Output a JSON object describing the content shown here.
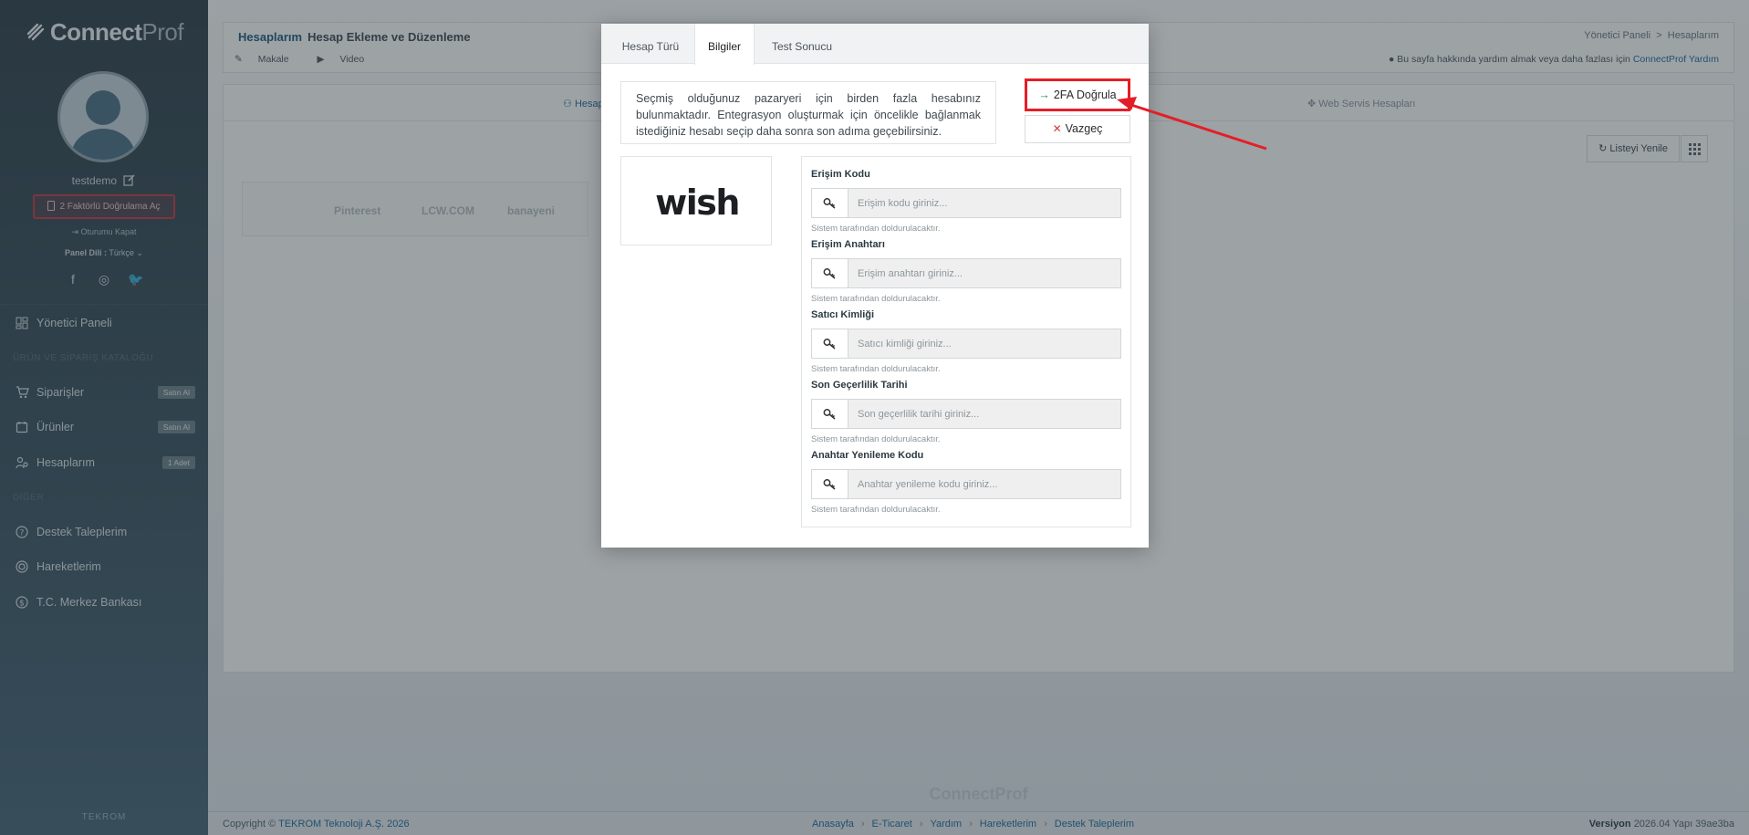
{
  "brand": {
    "name_bold": "Connect",
    "name_light": "Prof",
    "footer_brand": "TEKROM",
    "bottom_logo": "ConnectProf"
  },
  "user": {
    "name": "testdemo",
    "twofa_label": "2 Faktörlü Doğrulama Aç",
    "logout_label": "Oturumu Kapat",
    "panel_lang_label": "Panel Dili :",
    "panel_lang_value": "Türkçe"
  },
  "sidebar": {
    "items": [
      {
        "label": "Yönetici Paneli",
        "icon": "dashboard-icon"
      },
      {
        "section": "ÜRÜN VE SİPARİŞ KATALOĞU"
      },
      {
        "label": "Siparişler",
        "badge": "Satın Al",
        "icon": "cart-icon"
      },
      {
        "label": "Ürünler",
        "badge": "Satın Al",
        "icon": "tag-icon"
      },
      {
        "label": "Hesaplarım",
        "badge": "1 Adet",
        "icon": "users-icon"
      },
      {
        "section": "DİĞER"
      },
      {
        "label": "Destek Taleplerim",
        "icon": "help-icon"
      },
      {
        "label": "Hareketlerim",
        "icon": "activity-icon"
      },
      {
        "label": "T.C. Merkez Bankası",
        "icon": "currency-icon"
      }
    ]
  },
  "header": {
    "title": "Hesaplarım",
    "subtitle": "Hesap Ekleme ve Düzenleme",
    "breadcrumb_home": "Yönetici Paneli",
    "breadcrumb_sep": ">",
    "breadcrumb_current": "Hesaplarım",
    "link_article": "Makale",
    "link_video": "Video",
    "help_text": "Bu sayfa hakkında yardım almak veya daha fazlası için",
    "help_link": "ConnectProf Yardım"
  },
  "content": {
    "tab_accounts": "Hesap",
    "tab_webservice": "Web Servis Hesapları",
    "refresh_label": "Listeyi Yenile",
    "markets": [
      "Pinterest",
      "LCW.COM",
      "banayeni"
    ]
  },
  "modal": {
    "tabs": [
      "Hesap Türü",
      "Bilgiler",
      "Test Sonucu"
    ],
    "active_tab": 1,
    "info_text": "Seçmiş olduğunuz pazaryeri için birden fazla hesabınız bulunmaktadır. Entegrasyon oluşturmak için öncelikle bağlanmak istediğiniz hesabı seçip daha sonra son adıma geçebilirsiniz.",
    "verify_label": "2FA Doğrula",
    "cancel_label": "Vazgeç",
    "marketplace_logo": "wish",
    "fields": [
      {
        "label": "Erişim Kodu",
        "placeholder": "Erişim kodu giriniz...",
        "value": "",
        "hint": "Sistem tarafından doldurulacaktır."
      },
      {
        "label": "Erişim Anahtarı",
        "placeholder": "Erişim anahtarı giriniz...",
        "value": "",
        "hint": "Sistem tarafından doldurulacaktır."
      },
      {
        "label": "Satıcı Kimliği",
        "placeholder": "Satıcı kimliği giriniz...",
        "value": "",
        "hint": "Sistem tarafından doldurulacaktır."
      },
      {
        "label": "Son Geçerlilik Tarihi",
        "placeholder": "Son geçerlilik tarihi giriniz...",
        "value": "",
        "hint": "Sistem tarafından doldurulacaktır."
      },
      {
        "label": "Anahtar Yenileme Kodu",
        "placeholder": "Anahtar yenileme kodu giriniz...",
        "value": "",
        "hint": "Sistem tarafından doldurulacaktır."
      }
    ]
  },
  "footer": {
    "copyright_prefix": "Copyright ©",
    "company": "TEKROM Teknoloji A.Ş. 2026",
    "links": [
      "Anasayfa",
      "E-Ticaret",
      "Yardım",
      "Hareketlerim",
      "Destek Taleplerim"
    ],
    "link_sep": "›",
    "version_label": "Versiyon",
    "version_value": "2026.04 Yapı 39ae3ba"
  },
  "colors": {
    "accent": "#1e6aa0",
    "highlight_red": "#e41e26",
    "sidebar_bg": "#2e3f49"
  }
}
